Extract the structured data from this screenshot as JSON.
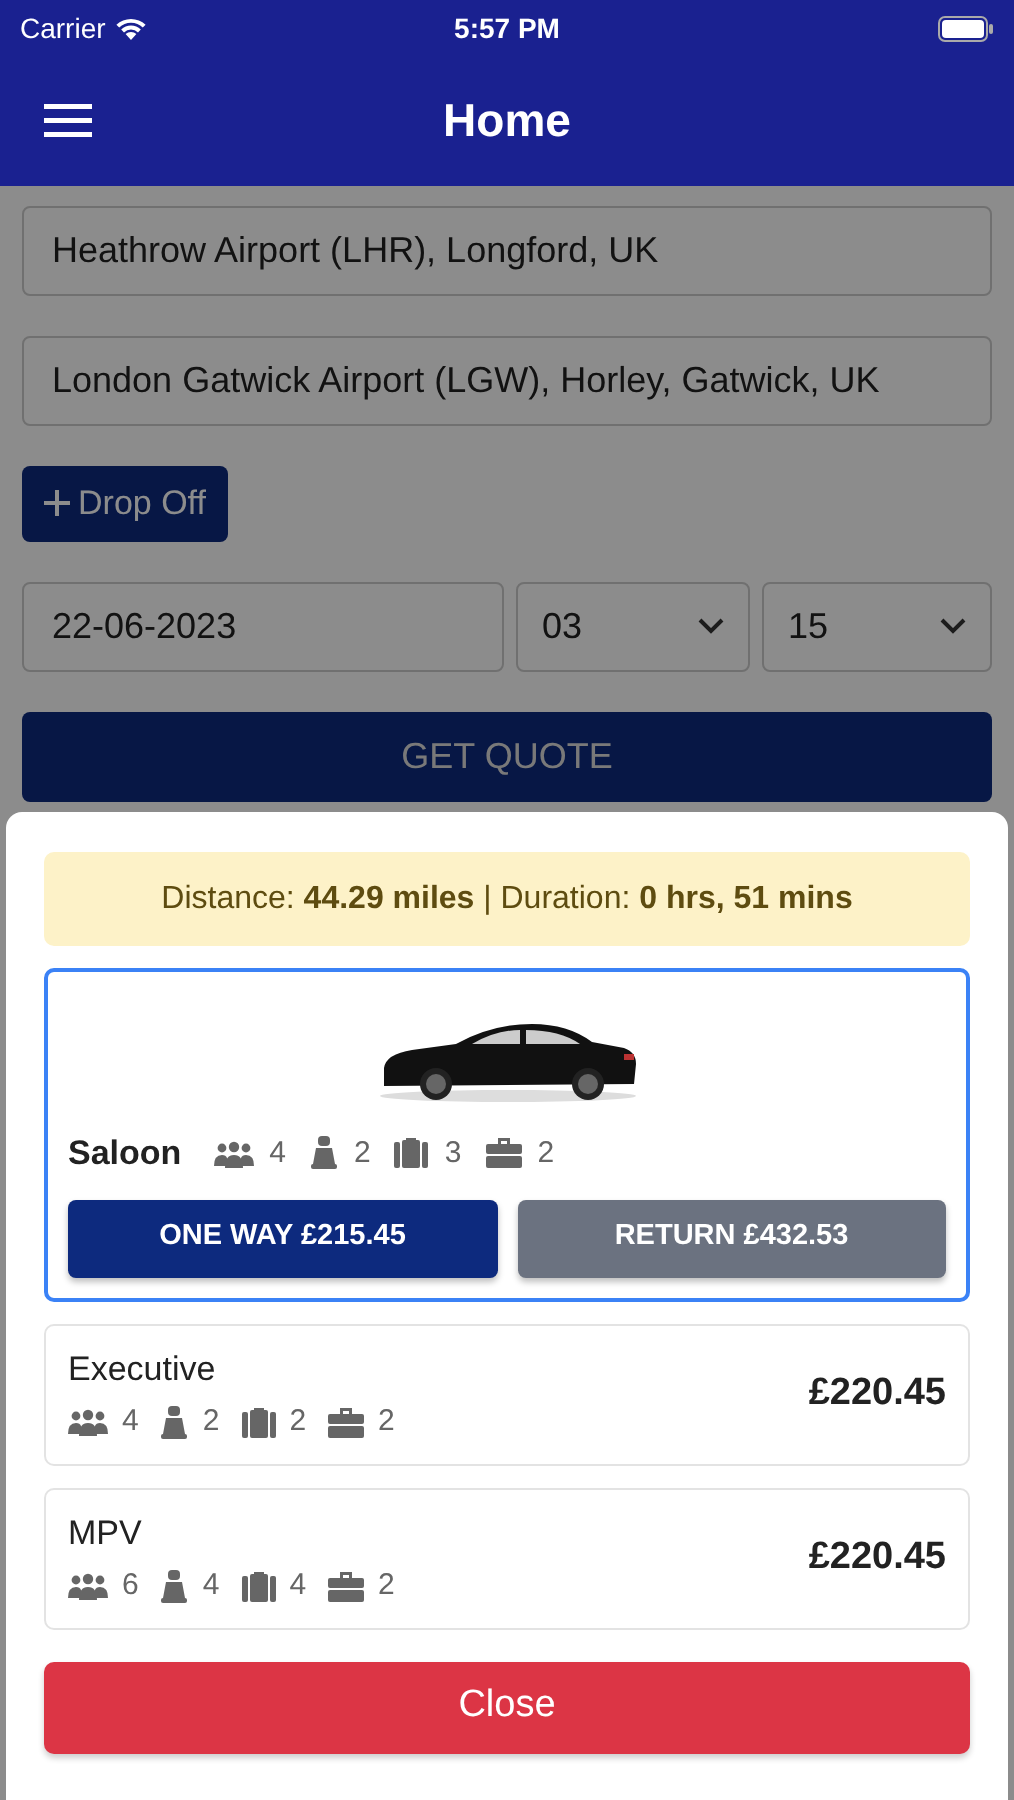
{
  "status_bar": {
    "carrier": "Carrier",
    "time": "5:57 PM"
  },
  "header": {
    "title": "Home"
  },
  "form": {
    "pickup": "Heathrow Airport (LHR), Longford, UK",
    "dropoff": "London Gatwick Airport (LGW), Horley, Gatwick, UK",
    "add_button": "Drop Off",
    "date": "22-06-2023",
    "hour": "03",
    "minute": "15",
    "submit": "GET QUOTE"
  },
  "quote": {
    "summary": "Distance: **44.29 miles** | Duration: **0 hrs, 51 mins**",
    "vehicles": [
      {
        "name": "Saloon",
        "selected": true,
        "passengers": "4",
        "child_seats": "2",
        "suitcases": "3",
        "carry_ons": "2",
        "one_way": "ONE WAY £215.45",
        "return": "RETURN £432.53"
      },
      {
        "name": "Executive",
        "selected": false,
        "passengers": "4",
        "child_seats": "2",
        "suitcases": "2",
        "carry_ons": "2",
        "price": "£220.45"
      },
      {
        "name": "MPV",
        "selected": false,
        "passengers": "6",
        "child_seats": "4",
        "suitcases": "4",
        "carry_ons": "2",
        "price": "£220.45"
      }
    ],
    "close": "Close"
  }
}
